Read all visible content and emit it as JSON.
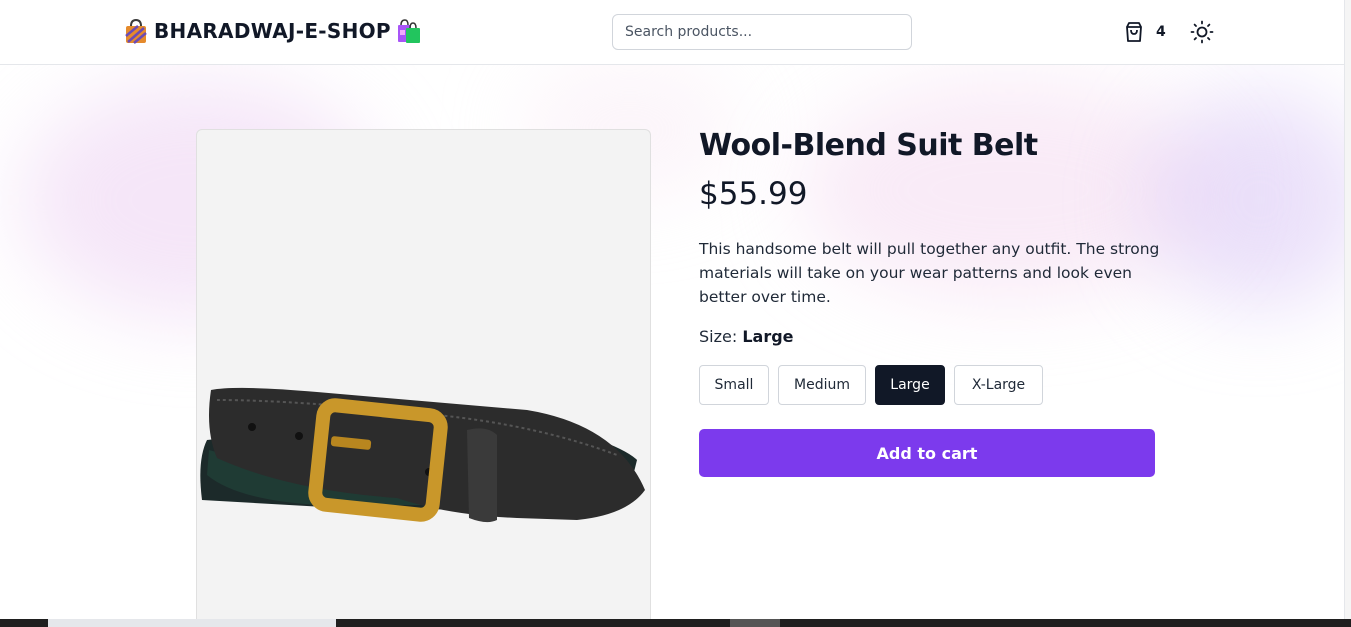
{
  "header": {
    "brand": "BHARADWAJ-E-SHOP",
    "search_placeholder": "Search products...",
    "cart_count": "4",
    "icons": {
      "brand_left": "shopping-bag-icon",
      "brand_right": "shopping-bags-icon",
      "cart": "shopping-bag-outline-icon",
      "theme": "sun-icon"
    }
  },
  "product": {
    "title": "Wool-Blend Suit Belt",
    "price": "$55.99",
    "description": "This handsome belt will pull together any outfit. The strong materials will take on your wear patterns and look even better over time.",
    "size_label": "Size:",
    "selected_size": "Large",
    "sizes": [
      "Small",
      "Medium",
      "Large",
      "X-Large"
    ],
    "add_to_cart": "Add to cart"
  },
  "colors": {
    "accent": "#7c3aed",
    "selected": "#111827"
  }
}
